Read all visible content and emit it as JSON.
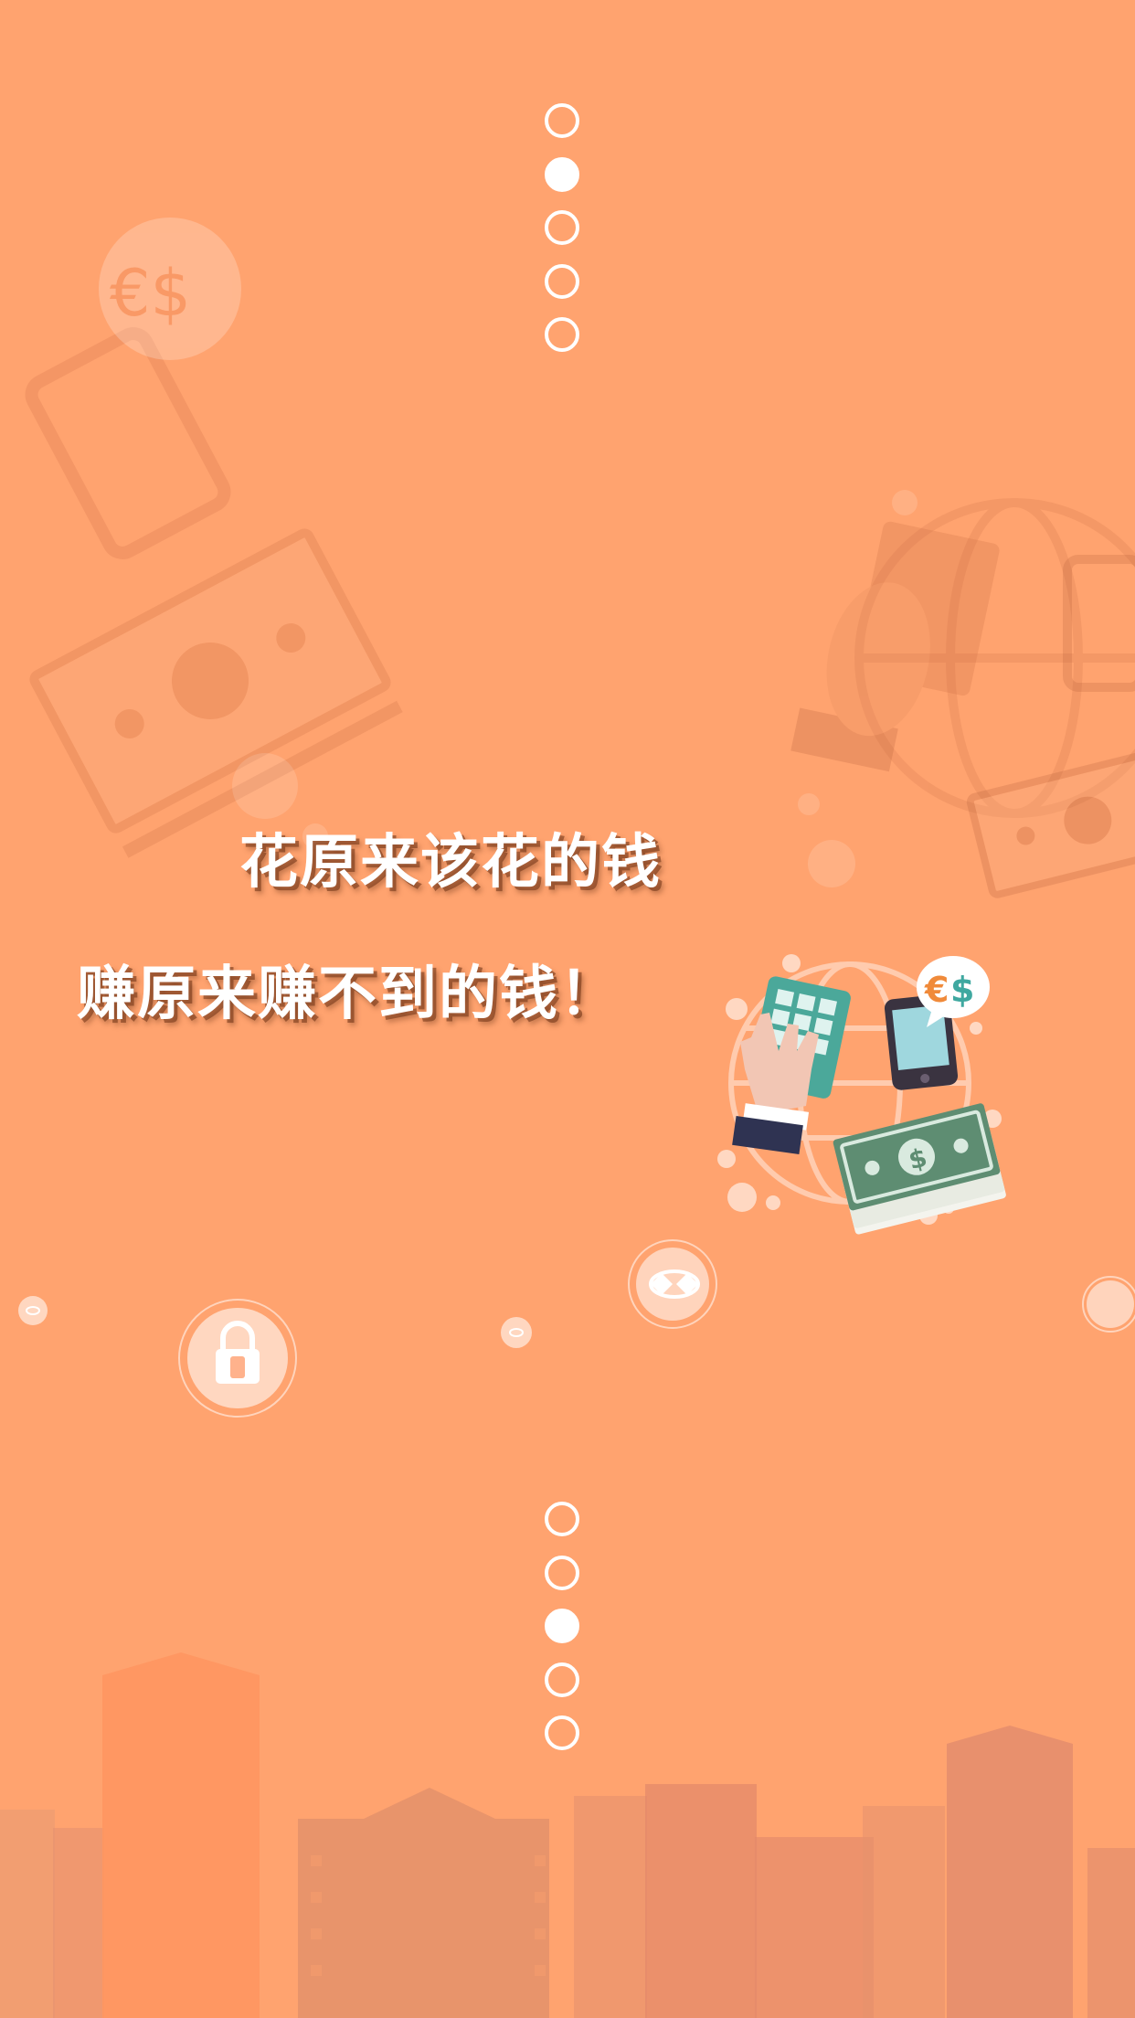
{
  "slogan": {
    "line1": "花原来该花的钱",
    "line2": "赚原来赚不到的钱！"
  },
  "pager_top": {
    "count": 5,
    "active_index": 1
  },
  "pager_bottom": {
    "count": 5,
    "active_index": 2
  },
  "icons": {
    "illustration": "finance-illustration-icon",
    "lock": "lock-icon",
    "exchange": "exchange-icon"
  },
  "colors": {
    "background": "#FFA36F",
    "text": "#FFFFFF",
    "teal": "#4BA89A",
    "cash_green": "#5E8D72"
  }
}
